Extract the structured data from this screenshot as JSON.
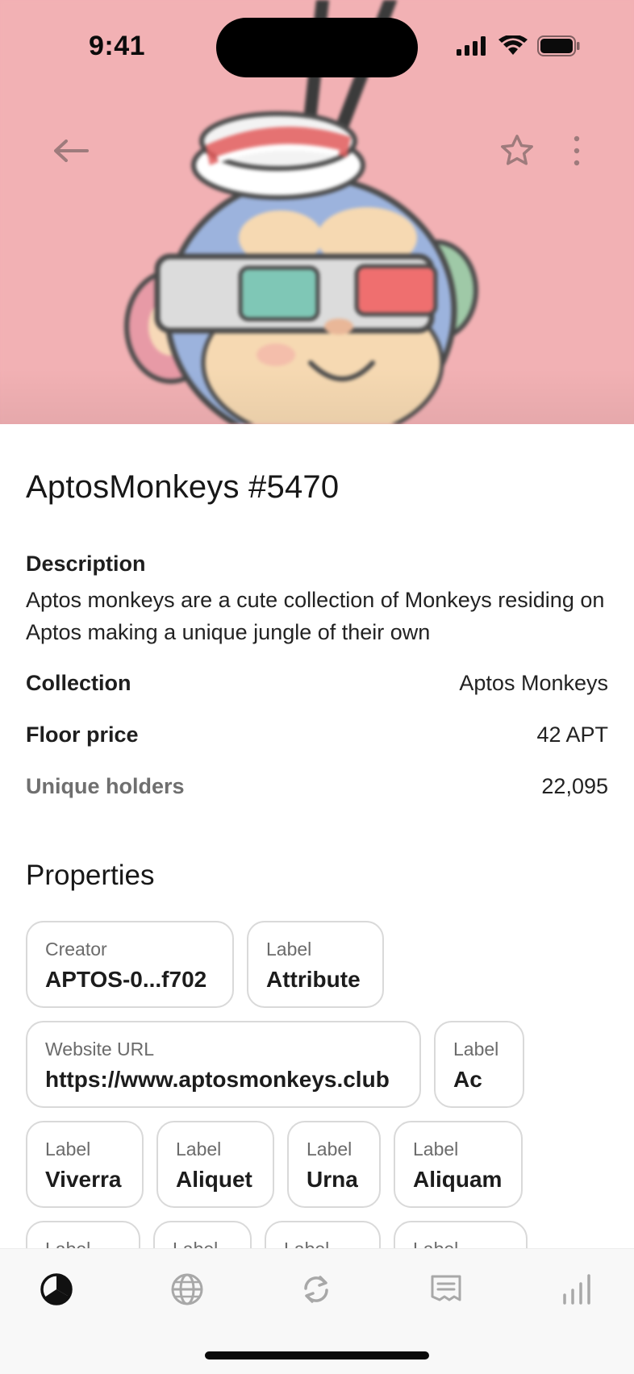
{
  "status_bar": {
    "time": "9:41"
  },
  "nft": {
    "title": "AptosMonkeys #5470",
    "description_label": "Description",
    "description": "Aptos monkeys are a cute collection of Monkeys residing on Aptos making a unique jungle of their own"
  },
  "details": [
    {
      "key": "Collection",
      "value": "Aptos Monkeys"
    },
    {
      "key": "Floor price",
      "value": "42 APT"
    },
    {
      "key": "Unique holders",
      "value": "22,095"
    }
  ],
  "properties": {
    "title": "Properties",
    "rows": [
      [
        {
          "label": "Creator",
          "value": "APTOS-0...f702"
        },
        {
          "label": "Label",
          "value": "Attribute"
        }
      ],
      [
        {
          "label": "Website URL",
          "value": "https://www.aptosmonkeys.club"
        },
        {
          "label": "Label",
          "value": "Ac"
        }
      ],
      [
        {
          "label": "Label",
          "value": "Viverra"
        },
        {
          "label": "Label",
          "value": "Aliquet"
        },
        {
          "label": "Label",
          "value": "Urna"
        },
        {
          "label": "Label",
          "value": "Aliquam"
        }
      ],
      [
        {
          "label": "Label",
          "value": ""
        },
        {
          "label": "Label",
          "value": ""
        },
        {
          "label": "Label",
          "value": ""
        },
        {
          "label": "Label",
          "value": ""
        }
      ]
    ]
  },
  "tabbar": {
    "tabs": [
      {
        "icon": "portfolio-icon",
        "active": true
      },
      {
        "icon": "globe-icon",
        "active": false
      },
      {
        "icon": "swap-icon",
        "active": false
      },
      {
        "icon": "receipt-icon",
        "active": false
      },
      {
        "icon": "signal-icon",
        "active": false
      }
    ]
  },
  "colors": {
    "hero_bg": "#f2b1b4",
    "text": "#1f1f1f",
    "muted": "#6f6f6f",
    "chip_border": "#d9d9d9"
  }
}
